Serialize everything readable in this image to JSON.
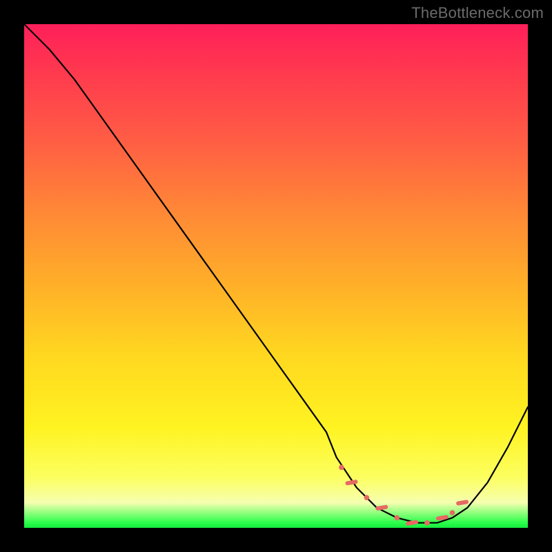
{
  "watermark": "TheBottleneck.com",
  "chart_data": {
    "type": "line",
    "title": "",
    "xlabel": "",
    "ylabel": "",
    "xlim": [
      0,
      100
    ],
    "ylim": [
      0,
      100
    ],
    "grid": false,
    "legend": false,
    "background": "heatmap-gradient-red-to-green",
    "series": [
      {
        "name": "bottleneck-curve",
        "x": [
          0,
          5,
          10,
          15,
          20,
          25,
          30,
          35,
          40,
          45,
          50,
          55,
          60,
          62,
          66,
          70,
          74,
          78,
          82,
          85,
          88,
          92,
          96,
          100
        ],
        "values": [
          100,
          95,
          89,
          82,
          75,
          68,
          61,
          54,
          47,
          40,
          33,
          26,
          19,
          14,
          8,
          4,
          2,
          1,
          1,
          2,
          4,
          9,
          16,
          24
        ]
      }
    ],
    "markers": {
      "name": "highlighted-range",
      "x": [
        63,
        65,
        68,
        71,
        74,
        77,
        80,
        83,
        85,
        87
      ],
      "values": [
        12,
        9,
        6,
        4,
        2,
        1,
        1,
        2,
        3,
        5
      ]
    }
  }
}
